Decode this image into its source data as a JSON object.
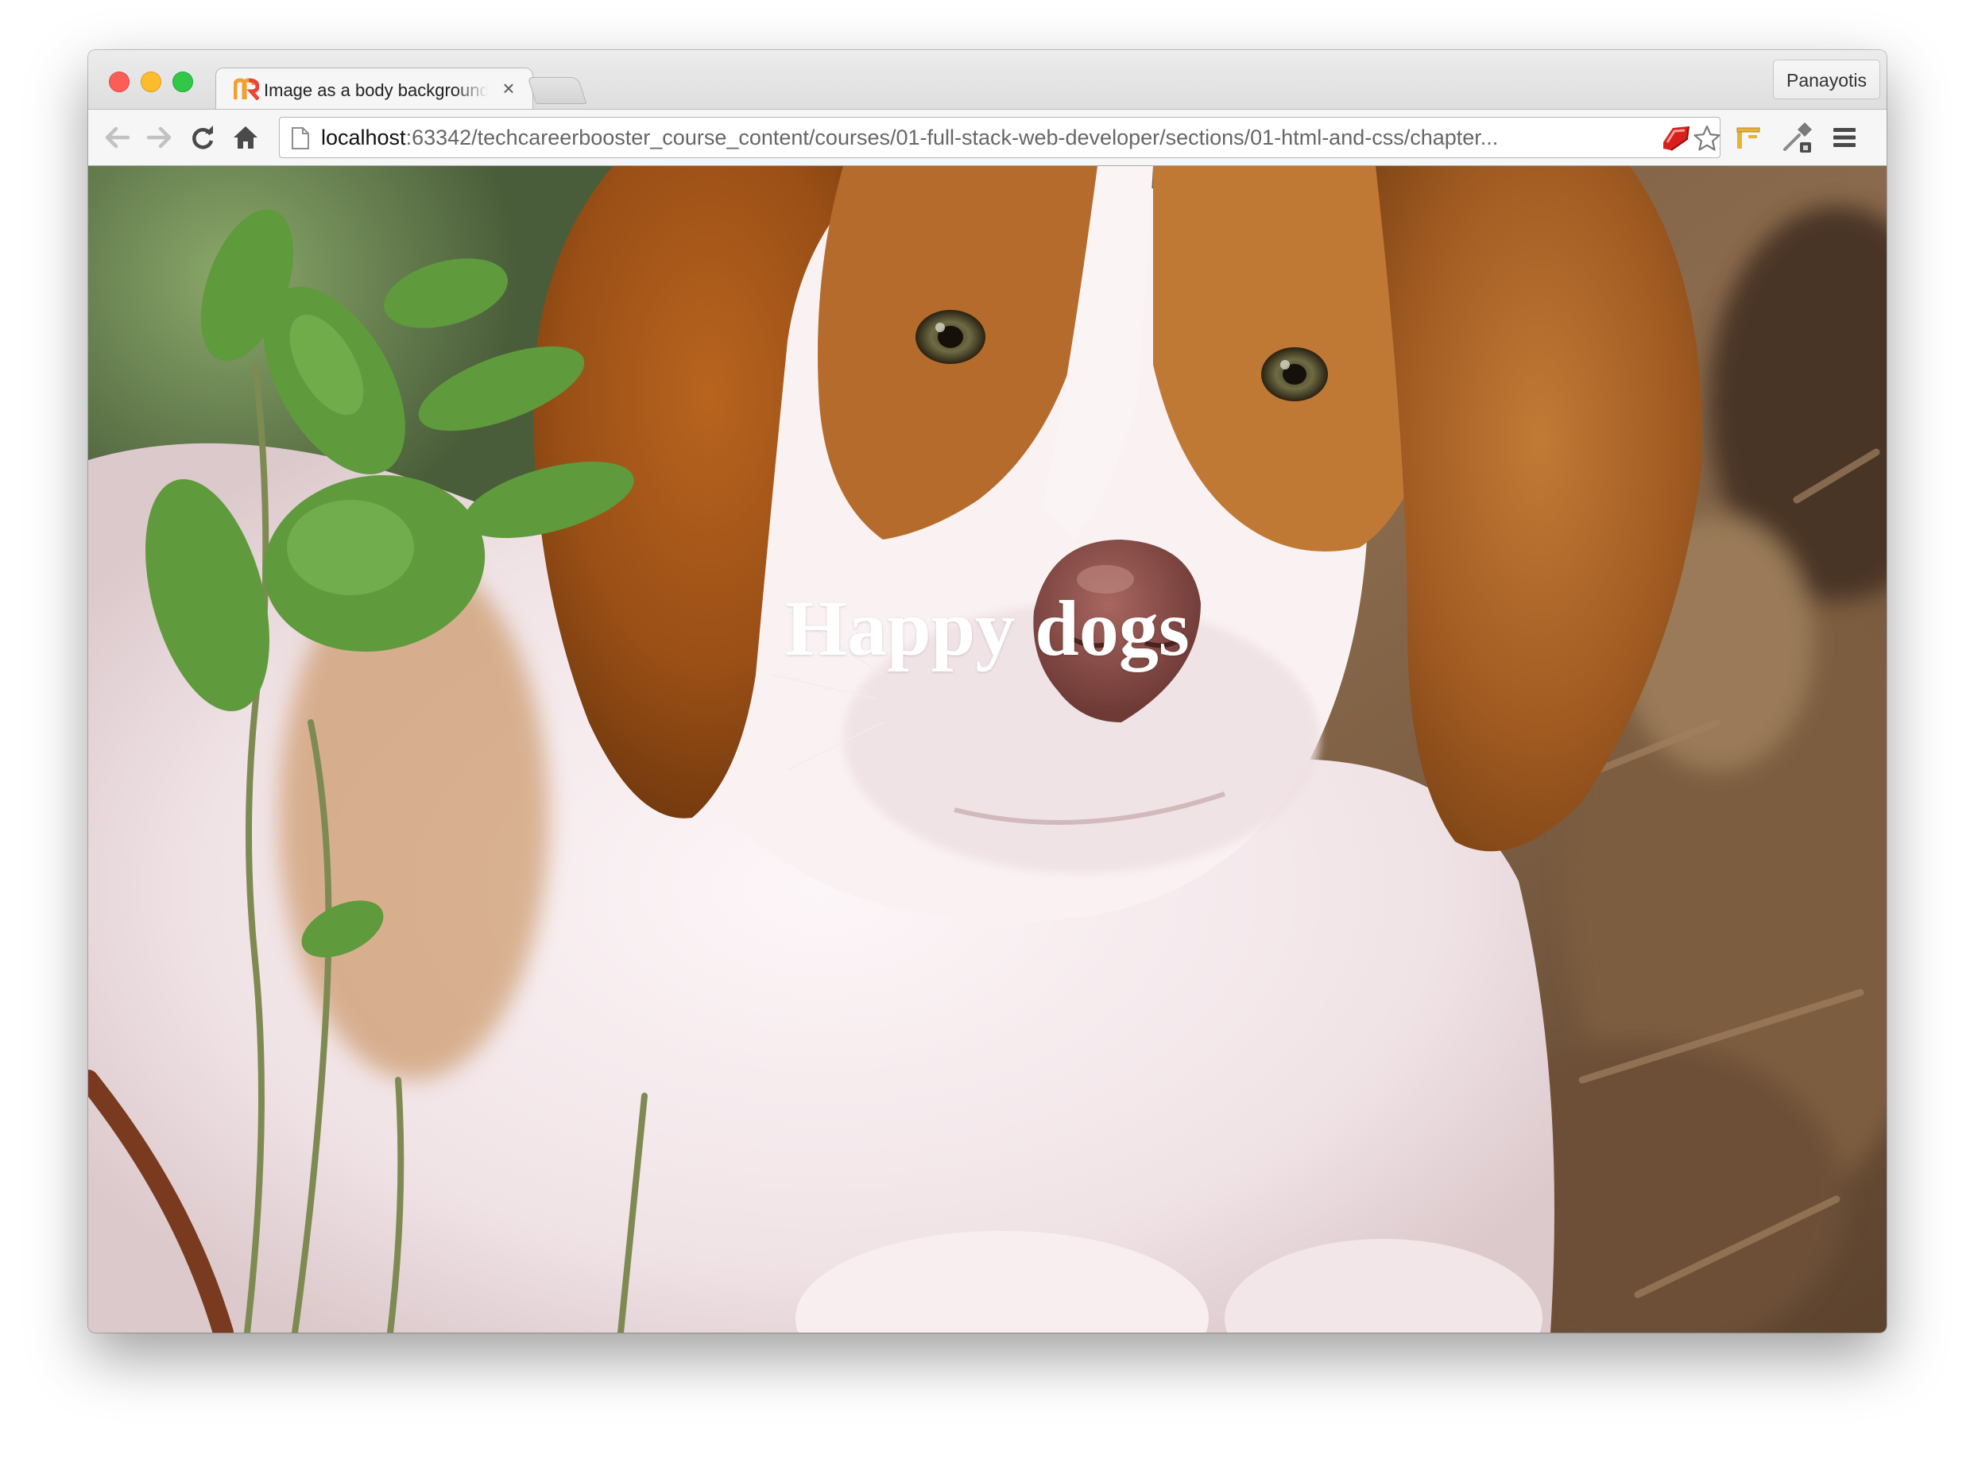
{
  "browser": {
    "profile_name": "Panayotis",
    "tab": {
      "title": "Image as a body background",
      "close_glyph": "×"
    },
    "address": {
      "host": "localhost",
      "rest": ":63342/techcareerbooster_course_content/courses/01-full-stack-web-developer/sections/01-html-and-css/chapter..."
    }
  },
  "page": {
    "heading": "Happy dogs"
  },
  "colors": {
    "close_light": "#fc5e57",
    "minimize_light": "#fdbc2e",
    "maximize_light": "#33c748",
    "favicon_orange": "#f0a030",
    "favicon_red": "#e8443a",
    "heading_text": "#ffffff"
  },
  "icons": [
    "back-arrow-icon",
    "forward-arrow-icon",
    "reload-icon",
    "home-icon",
    "page-icon",
    "ruby-extension-icon",
    "bookmark-star-icon",
    "extension-tool-icon",
    "eyedropper-icon",
    "menu-icon",
    "tab-close-icon"
  ]
}
